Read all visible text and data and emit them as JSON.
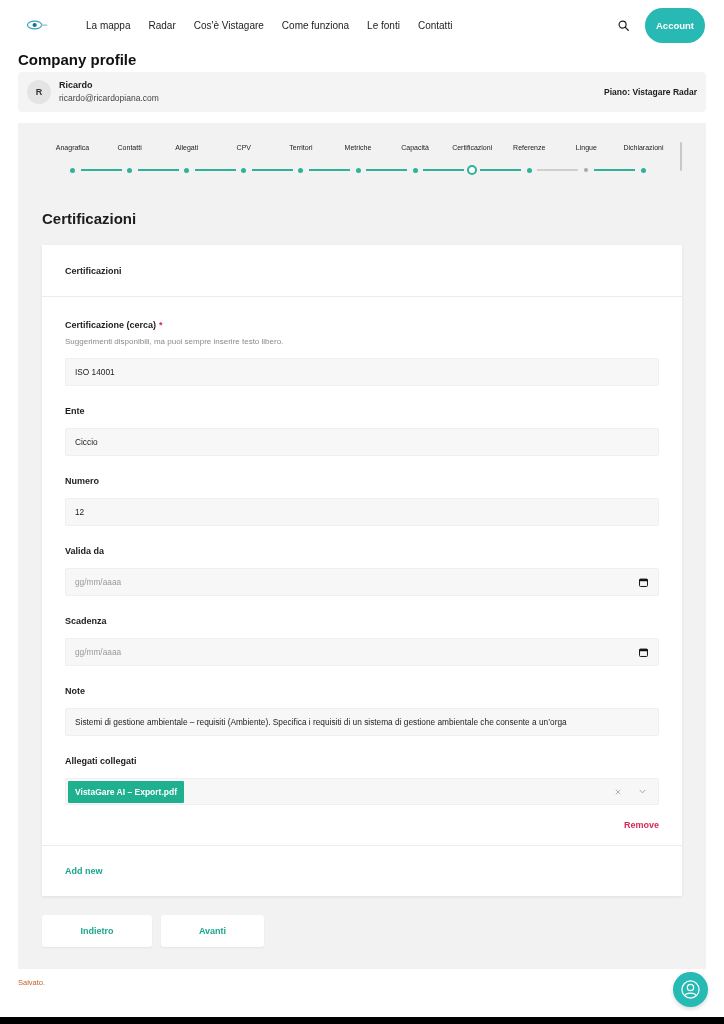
{
  "header": {
    "nav": [
      "La mappa",
      "Radar",
      "Cos'è Vistagare",
      "Come funziona",
      "Le fonti",
      "Contatti"
    ],
    "account_button": "Account"
  },
  "page_title": "Company profile",
  "profile": {
    "avatar_initial": "R",
    "name": "Ricardo",
    "email": "ricardo@ricardopiana.com",
    "plan": "Piano: Vistagare Radar"
  },
  "stepper": {
    "steps": [
      {
        "label": "Anagrafica",
        "selected": false,
        "completed": true
      },
      {
        "label": "Contatti",
        "selected": false,
        "completed": true
      },
      {
        "label": "Allegati",
        "selected": false,
        "completed": true
      },
      {
        "label": "CPV",
        "selected": false,
        "completed": true
      },
      {
        "label": "Territori",
        "selected": false,
        "completed": true
      },
      {
        "label": "Metriche",
        "selected": false,
        "completed": true
      },
      {
        "label": "Capacità",
        "selected": false,
        "completed": true
      },
      {
        "label": "Certificazioni",
        "selected": true,
        "completed": true
      },
      {
        "label": "Referenze",
        "selected": false,
        "completed": true
      },
      {
        "label": "Lingue",
        "selected": false,
        "completed": false
      },
      {
        "label": "Dichiarazioni",
        "selected": false,
        "completed": true
      }
    ]
  },
  "section_title": "Certificazioni",
  "card": {
    "title": "Certificazioni",
    "fields": [
      {
        "kind": "text",
        "label": "Certificazione (cerca)",
        "required_mark": "*",
        "hint": "Suggerimenti disponibili, ma puoi sempre inserire testo libero.",
        "value": "ISO 14001"
      },
      {
        "kind": "text",
        "label": "Ente",
        "value": "Ciccio"
      },
      {
        "kind": "text",
        "label": "Numero",
        "value": "12"
      },
      {
        "kind": "date",
        "label": "Valida da",
        "placeholder": "gg/mm/aaaa"
      },
      {
        "kind": "date",
        "label": "Scadenza",
        "placeholder": "gg/mm/aaaa"
      },
      {
        "kind": "text",
        "label": "Note",
        "value": "Sistemi di gestione ambientale – requisiti (Ambiente). Specifica i requisiti di un sistema di gestione ambientale che consente a un’orga"
      },
      {
        "kind": "select",
        "label": "Allegati collegati",
        "chips": [
          "VistaGare AI – Export.pdf"
        ]
      }
    ],
    "remove_link": "Remove",
    "add_link": "Add new"
  },
  "buttons": [
    {
      "kind": "back",
      "label": "Indietro"
    },
    {
      "kind": "next",
      "label": "Avanti"
    }
  ],
  "status_message": "Salvato."
}
